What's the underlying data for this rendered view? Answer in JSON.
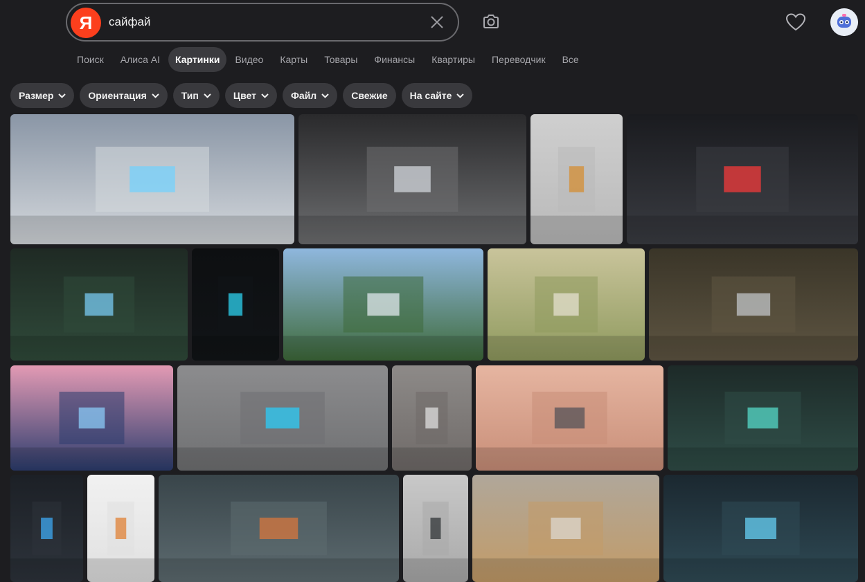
{
  "search": {
    "logo_letter": "Я",
    "query": "сайфай"
  },
  "tabs": [
    {
      "label": "Поиск",
      "active": false
    },
    {
      "label": "Алиса AI",
      "active": false
    },
    {
      "label": "Картинки",
      "active": true
    },
    {
      "label": "Видео",
      "active": false
    },
    {
      "label": "Карты",
      "active": false
    },
    {
      "label": "Товары",
      "active": false
    },
    {
      "label": "Финансы",
      "active": false
    },
    {
      "label": "Квартиры",
      "active": false
    },
    {
      "label": "Переводчик",
      "active": false
    },
    {
      "label": "Все",
      "active": false
    }
  ],
  "filters": [
    {
      "label": "Размер",
      "dropdown": true
    },
    {
      "label": "Ориентация",
      "dropdown": true
    },
    {
      "label": "Тип",
      "dropdown": true
    },
    {
      "label": "Цвет",
      "dropdown": true
    },
    {
      "label": "Файл",
      "dropdown": true
    },
    {
      "label": "Свежие",
      "dropdown": false
    },
    {
      "label": "На сайте",
      "dropdown": true
    }
  ],
  "icons": {
    "clear": "close-icon",
    "camera": "camera-search-icon",
    "favorites": "heart-icon",
    "avatar": "robot-avatar"
  },
  "colors": {
    "background": "#1d1d20",
    "chip": "#39393d",
    "active_tab": "#3b3b3f",
    "brand": "#fc3f1d"
  },
  "images": [
    {
      "name": "floating-city-clouds",
      "sky": "#8a96a6",
      "ground": "#d4d8dc",
      "accent": "#6fd2ff"
    },
    {
      "name": "spaceship-corridor-white",
      "sky": "#2a2a2c",
      "ground": "#6d6e70",
      "accent": "#d8dde2"
    },
    {
      "name": "astronaut-woman-concept",
      "sky": "#cfcfcf",
      "ground": "#b9b9b9",
      "accent": "#d68a2a"
    },
    {
      "name": "red-neon-corridor",
      "sky": "#1a1b1f",
      "ground": "#3a3c42",
      "accent": "#ff3b3b"
    },
    {
      "name": "green-industrial-hangar",
      "sky": "#1f2a24",
      "ground": "#2f4a3a",
      "accent": "#7ed3ff"
    },
    {
      "name": "glowing-cyan-capsule",
      "sky": "#0d0f11",
      "ground": "#111417",
      "accent": "#2fe0ff"
    },
    {
      "name": "futuristic-bridge-city",
      "sky": "#8fb7de",
      "ground": "#3e6a3a",
      "accent": "#e8eef5"
    },
    {
      "name": "desert-base-satellite",
      "sky": "#c9c49b",
      "ground": "#8f9a5e",
      "accent": "#e9e4d6"
    },
    {
      "name": "scifi-living-room",
      "sky": "#3a3528",
      "ground": "#5e5542",
      "accent": "#c7ccd0"
    },
    {
      "name": "pink-alien-city",
      "sky": "#e39ab4",
      "ground": "#2c3d6e",
      "accent": "#8fd3ff"
    },
    {
      "name": "hover-pod-vehicle",
      "sky": "#8c8c8e",
      "ground": "#6f7072",
      "accent": "#27d2ff"
    },
    {
      "name": "woman-with-tablet",
      "sky": "#8d8a88",
      "ground": "#6f6a68",
      "accent": "#e5e5e5"
    },
    {
      "name": "mars-colony-structure",
      "sky": "#e6b5a1",
      "ground": "#c88e78",
      "accent": "#4d4f55"
    },
    {
      "name": "overgrown-tech-chamber",
      "sky": "#1d2a28",
      "ground": "#2f4d47",
      "accent": "#59e3d2"
    },
    {
      "name": "armored-soldier-dark",
      "sky": "#1c2026",
      "ground": "#2d333b",
      "accent": "#3fb0ff"
    },
    {
      "name": "woman-in-white-suit",
      "sky": "#f1f1f1",
      "ground": "#e0e0e0",
      "accent": "#e07b2a"
    },
    {
      "name": "lab-interior-orange",
      "sky": "#39454a",
      "ground": "#5d6b70",
      "accent": "#e0773a"
    },
    {
      "name": "pilot-in-black-suit",
      "sky": "#c8c8c8",
      "ground": "#a9a9a9",
      "accent": "#2a2d31"
    },
    {
      "name": "desert-outpost-wreck",
      "sky": "#b0a79a",
      "ground": "#c29b67",
      "accent": "#dedcd6"
    },
    {
      "name": "server-room-blue",
      "sky": "#1b2830",
      "ground": "#2f4a55",
      "accent": "#6ad8ff"
    }
  ]
}
